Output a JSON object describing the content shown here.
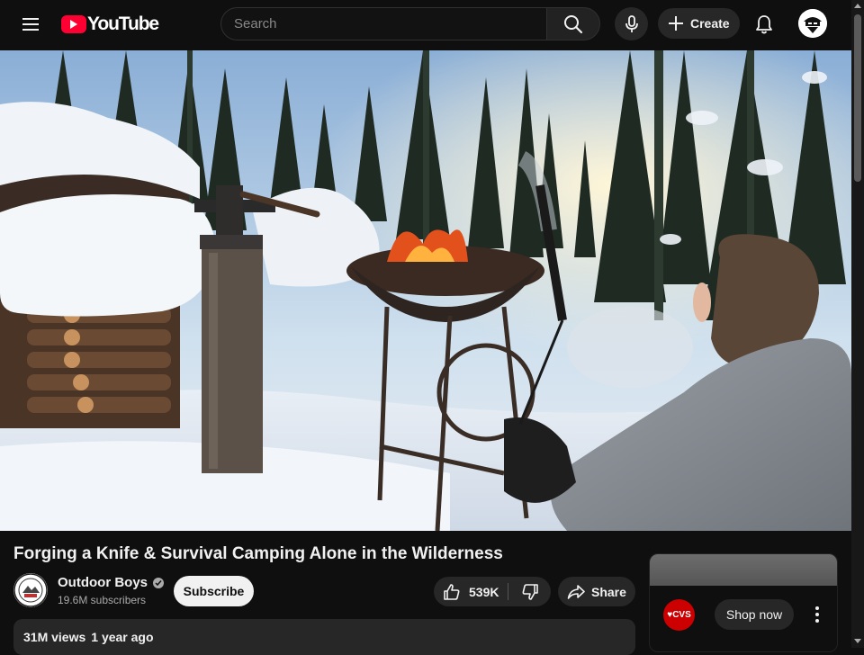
{
  "masthead": {
    "logo_text": "YouTube",
    "search_placeholder": "Search",
    "create_label": "Create"
  },
  "video": {
    "title": "Forging a Knife & Survival Camping Alone in the Wilderness",
    "views": "31M views",
    "published": "1 year ago",
    "likes": "539K"
  },
  "channel": {
    "name": "Outdoor Boys",
    "subscribers": "19.6M subscribers",
    "subscribe_label": "Subscribe"
  },
  "actions": {
    "share_label": "Share"
  },
  "ad": {
    "brand": "♥CVS",
    "cta_label": "Shop now"
  },
  "colors": {
    "background": "#0f0f0f",
    "brand_red": "#ff0033",
    "chip": "#272727"
  }
}
